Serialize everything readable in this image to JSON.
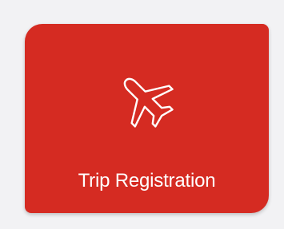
{
  "tile": {
    "label": "Trip Registration",
    "icon": "airplane-icon",
    "background_color": "#d52b22",
    "text_color": "#ffffff"
  }
}
